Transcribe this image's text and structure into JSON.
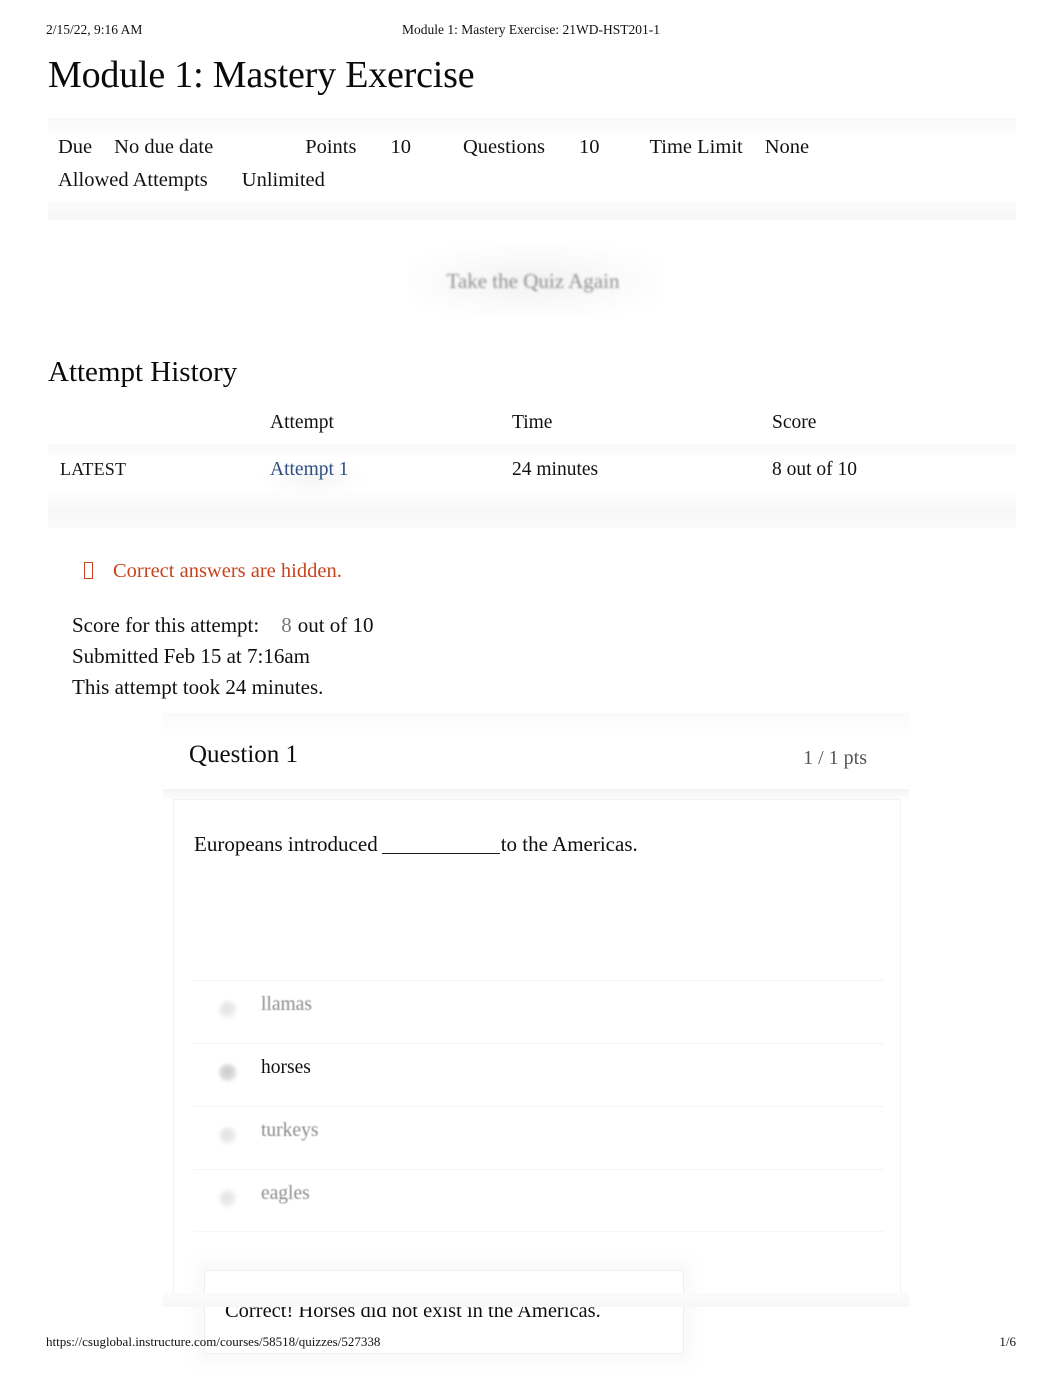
{
  "print": {
    "header_left": "2/15/22, 9:16 AM",
    "header_center": "Module 1: Mastery Exercise: 21WD-HST201-1",
    "footer_url": "https://csuglobal.instructure.com/courses/58518/quizzes/527338",
    "footer_page": "1/6"
  },
  "page": {
    "title": "Module 1: Mastery Exercise"
  },
  "quiz_meta": {
    "due_label": "Due",
    "due_value": "No due date",
    "points_label": "Points",
    "points_value": "10",
    "questions_label": "Questions",
    "questions_value": "10",
    "time_limit_label": "Time Limit",
    "time_limit_value": "None",
    "allowed_attempts_label": "Allowed Attempts",
    "allowed_attempts_value": "Unlimited"
  },
  "actions": {
    "retake_label": "Take the Quiz Again"
  },
  "attempt_history": {
    "heading": "Attempt History",
    "columns": [
      "",
      "Attempt",
      "Time",
      "Score"
    ],
    "rows": [
      {
        "kept": "LATEST",
        "attempt": "Attempt 1",
        "time": "24 minutes",
        "score": "8 out of 10"
      }
    ]
  },
  "notice": {
    "icon": "warning-icon",
    "text": "Correct answers are hidden.",
    "color": "#c8431c"
  },
  "score_summary": {
    "score_label": "Score for this attempt:",
    "score_value": "8",
    "score_suffix": "out of 10",
    "submitted": "Submitted Feb 15 at 7:16am",
    "duration": "This attempt took 24 minutes."
  },
  "question": {
    "title": "Question 1",
    "points": "1 / 1 pts",
    "text_before": "Europeans introduced",
    "text_after": "to the Americas.",
    "answers": [
      {
        "label": "llamas",
        "selected": false
      },
      {
        "label": "horses",
        "selected": true
      },
      {
        "label": "turkeys",
        "selected": false
      },
      {
        "label": "eagles",
        "selected": false
      }
    ],
    "feedback": "Correct! Horses did not exist in the Americas."
  }
}
